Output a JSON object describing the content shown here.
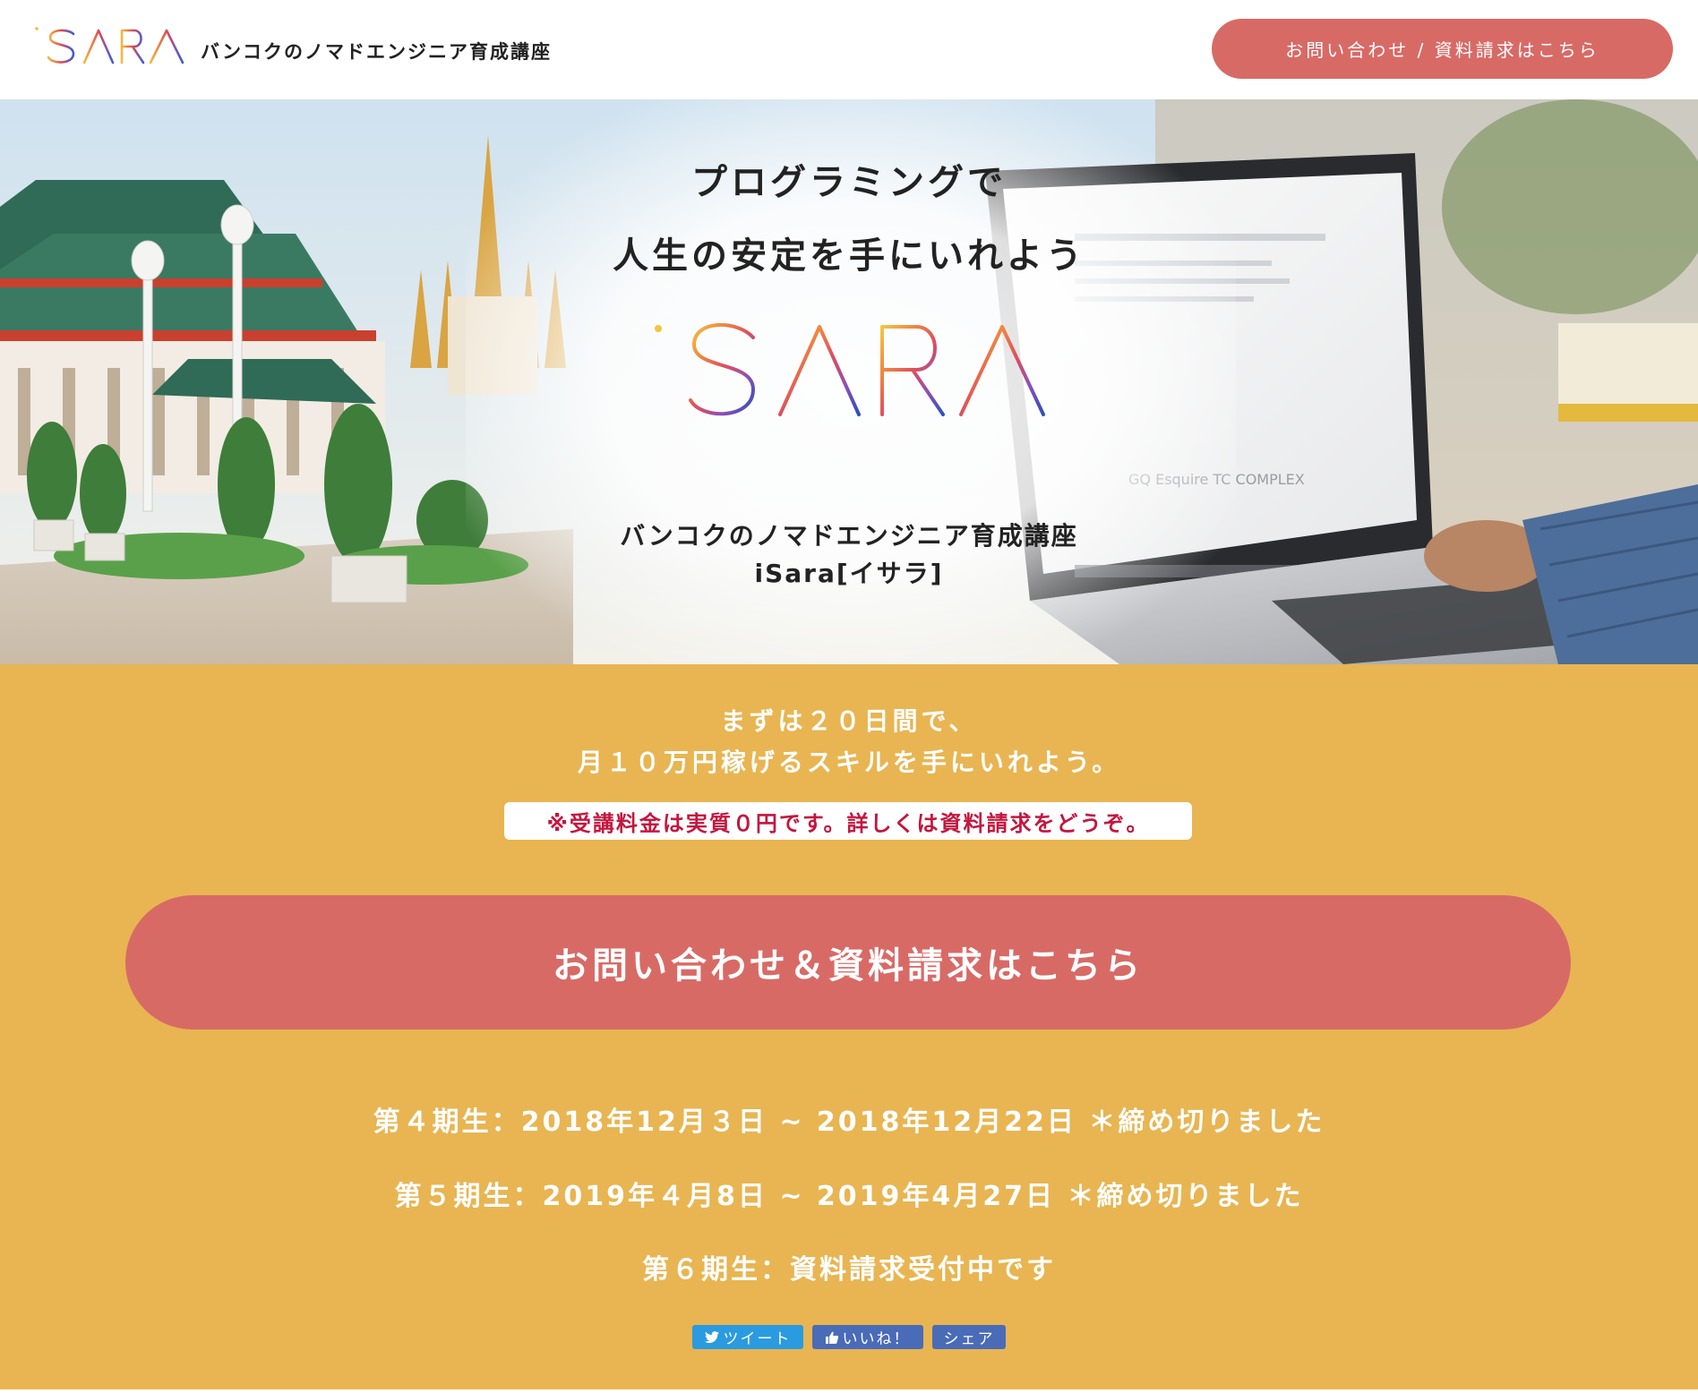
{
  "header": {
    "logo_text": "iSARA",
    "tagline": "バンコクのノマドエンジニア育成講座",
    "cta_label": "お問い合わせ / 資料請求はこちら"
  },
  "hero": {
    "headline_line1": "プログラミングで",
    "headline_line2": "人生の安定を手にいれよう",
    "logo_text": "iSARA",
    "subtitle_line1": "バンコクのノマドエンジニア育成講座",
    "subtitle_line2": "iSara[イサラ]"
  },
  "promo": {
    "line1": "まずは２０日間で、",
    "line2": "月１０万円稼げるスキルを手にいれよう。",
    "note": "※受講料金は実質０円です。詳しくは資料請求をどうぞ。",
    "cta_label": "お問い合わせ＆資料請求はこちら",
    "terms": [
      "第４期生：2018年12月３日 ~ 2018年12月22日 ＊締め切りました",
      "第５期生：2019年４月8日 ~ 2019年4月27日 ＊締め切りました",
      "第６期生：資料請求受付中です"
    ]
  },
  "share": {
    "tweet": "ツイート",
    "like": "いいね！",
    "share": "シェア"
  },
  "colors": {
    "accent_button": "#d86a66",
    "promo_background": "#e8b552",
    "note_text": "#c4163f",
    "twitter": "#2a9be0",
    "facebook": "#4a6bb8"
  },
  "icons": [
    "twitter-bird-icon",
    "thumbs-up-icon"
  ]
}
